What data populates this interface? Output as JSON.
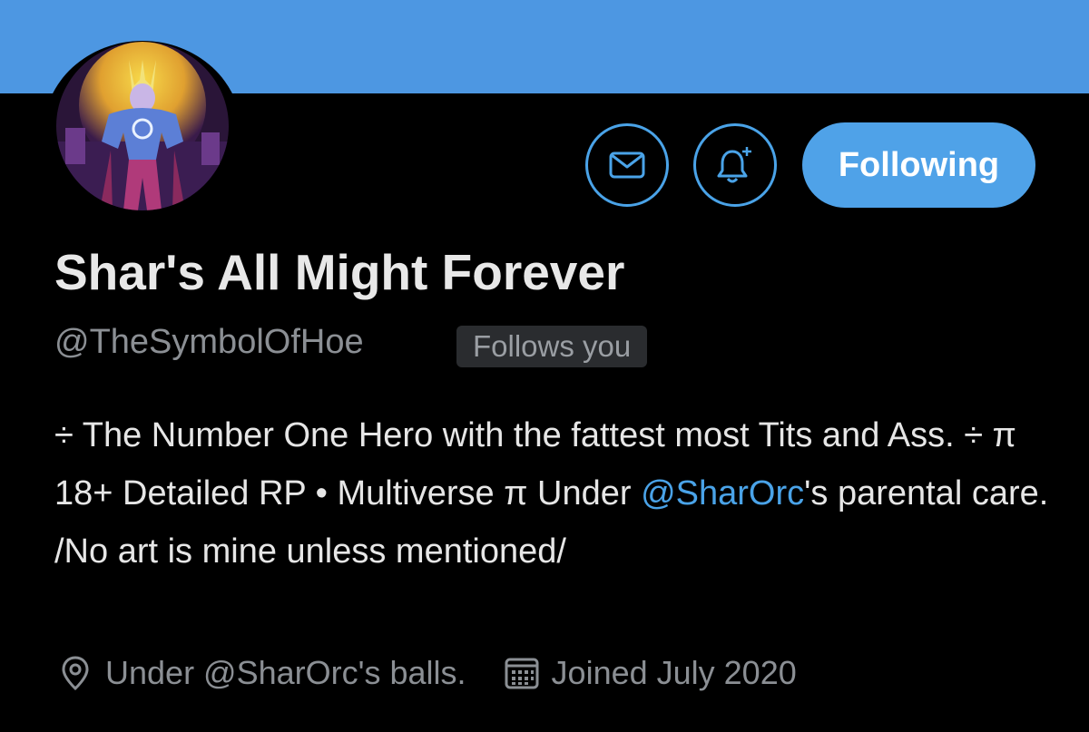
{
  "colors": {
    "banner": "#4d97e2",
    "accent": "#4aa3e8",
    "background": "#000000",
    "button_bg": "#4fa2e8"
  },
  "actions": {
    "message_icon": "mail-icon",
    "notify_icon": "bell-plus-icon",
    "following_label": "Following"
  },
  "profile": {
    "display_name": "Shar's All Might Forever",
    "handle": "@TheSymbolOfHoe",
    "follows_you": "Follows you",
    "bio": {
      "part1": "÷ The Number One Hero with the fattest most Tits and Ass. ÷ π 18+ Detailed RP • Multiverse π Under ",
      "mention": "@SharOrc",
      "part2": "'s parental care. /No art is mine unless mentioned/"
    },
    "location": "Under @SharOrc's balls.",
    "location_icon": "location-pin-icon",
    "joined": "Joined July 2020",
    "joined_icon": "calendar-icon"
  }
}
